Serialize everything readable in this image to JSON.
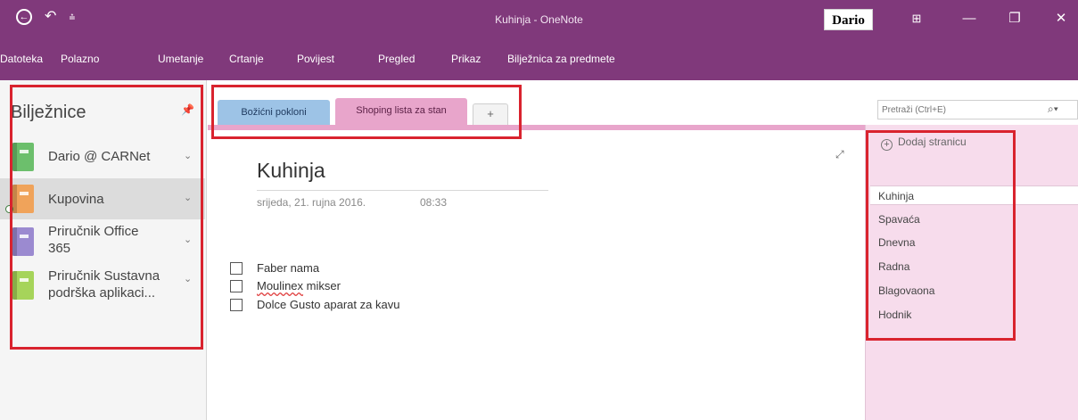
{
  "window": {
    "title": "Kuhinja - OneNote",
    "user": "Dario",
    "minimize": "—",
    "restore": "❐",
    "close": "✕",
    "display_options": "⊞",
    "qat_back": "←",
    "qat_undo": "↶",
    "qat_customize": "⩮"
  },
  "ribbon": {
    "tabs": [
      "Datoteka",
      "Polazno",
      "Umetanje",
      "Crtanje",
      "Povijest",
      "Pregled",
      "Prikaz",
      "Bilježnica za predmete"
    ]
  },
  "notebooks": {
    "header": "Bilježnice",
    "pin": "📌",
    "items": [
      {
        "line1": "Dario @ CARNet",
        "line2": "",
        "color": "#6cbf6c"
      },
      {
        "line1": "Kupovina",
        "line2": "",
        "color": "#f0a35a"
      },
      {
        "line1": "Priručnik Office",
        "line2": "365",
        "color": "#9b8ad0"
      },
      {
        "line1": "Priručnik Sustavna",
        "line2": "podrška aplikaci...",
        "color": "#a6d45a"
      }
    ]
  },
  "sections": {
    "tabs": [
      {
        "label": "Božićni pokloni",
        "color": "#9dc3e6"
      },
      {
        "label": "Shoping lista za stan",
        "color": "#e8a5cb"
      }
    ],
    "add_label": "+"
  },
  "page": {
    "title": "Kuhinja",
    "date": "srijeda, 21. rujna 2016.",
    "time": "08:33",
    "todos": [
      "Faber nama",
      "Moulinex mikser",
      "Dolce Gusto aparat za kavu"
    ],
    "todo_misspelled": "Moulinex",
    "todo_rest": " mikser"
  },
  "pages_pane": {
    "search_placeholder": "Pretraži (Ctrl+E)",
    "search_icon": "⌕▾",
    "add_page": "Dodaj stranicu",
    "pages": [
      "Kuhinja",
      "Spavaća",
      "Dnevna",
      "Radna",
      "Blagovaona",
      "Hodnik"
    ]
  },
  "colors": {
    "brand": "#80397b",
    "annotation": "#d9232e",
    "section_pink": "#e8a5cb",
    "section_blue": "#9dc3e6"
  }
}
